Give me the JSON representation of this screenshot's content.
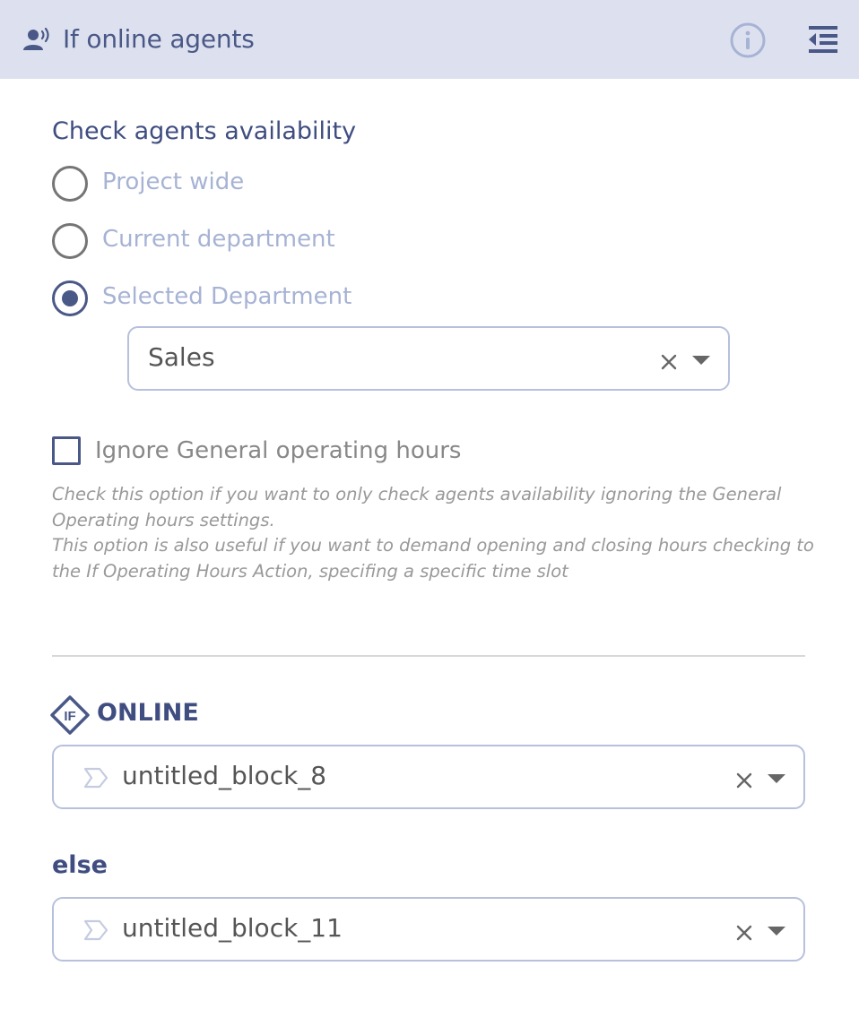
{
  "header": {
    "title": "If online agents",
    "icons": {
      "action": "agent-speaking-icon",
      "info": "info-icon",
      "collapse": "collapse-panel-icon"
    }
  },
  "availability": {
    "title": "Check agents availability",
    "options": [
      {
        "label": "Project wide",
        "checked": false
      },
      {
        "label": "Current department",
        "checked": false
      },
      {
        "label": "Selected Department",
        "checked": true
      }
    ],
    "department_select": {
      "value": "Sales"
    }
  },
  "ignore_hours": {
    "label": "Ignore General operating hours",
    "checked": false,
    "help_lines": [
      "Check this option if you want to only check agents availability ignoring the General Operating hours settings.",
      "This option is also useful if you want to demand opening and closing hours checking to the If Operating Hours Action, specifing a specific time slot"
    ]
  },
  "online_branch": {
    "badge": "IF",
    "label": "ONLINE",
    "block": "untitled_block_8"
  },
  "else_branch": {
    "label": "else",
    "block": "untitled_block_11"
  },
  "colors": {
    "header_bg": "#dde1ef",
    "accent": "#4a5887",
    "label_muted": "#a7b3d4",
    "border": "#b7c0dd"
  }
}
